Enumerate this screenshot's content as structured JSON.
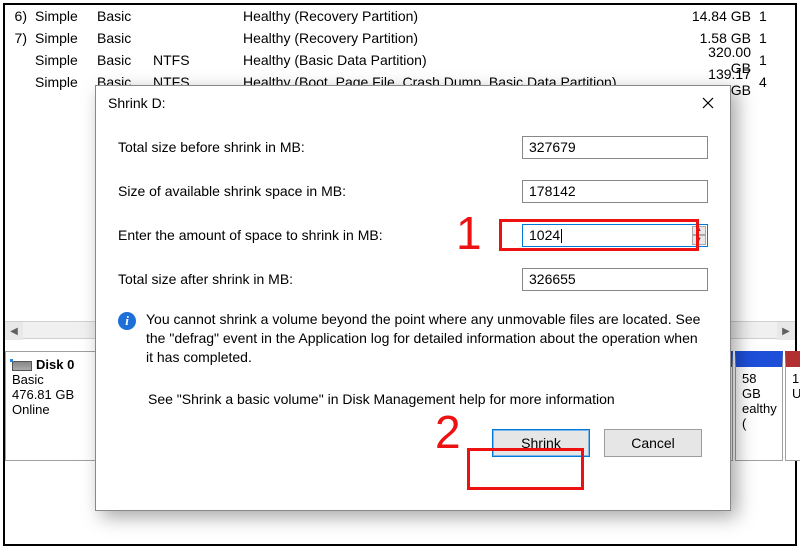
{
  "bg": {
    "rows": [
      {
        "num": "6)",
        "layout": "Simple",
        "type": "Basic",
        "fs": "",
        "status": "Healthy (Recovery Partition)",
        "cap": "14.84 GB",
        "free": "1"
      },
      {
        "num": "7)",
        "layout": "Simple",
        "type": "Basic",
        "fs": "",
        "status": "Healthy (Recovery Partition)",
        "cap": "1.58 GB",
        "free": "1"
      },
      {
        "num": "",
        "layout": "Simple",
        "type": "Basic",
        "fs": "NTFS",
        "status": "Healthy (Basic Data Partition)",
        "cap": "320.00 GB",
        "free": "1"
      },
      {
        "num": "",
        "layout": "Simple",
        "type": "Basic",
        "fs": "NTFS",
        "status": "Healthy (Boot, Page File, Crash Dump, Basic Data Partition)",
        "cap": "139.17 GB",
        "free": "4"
      }
    ]
  },
  "disk": {
    "name": "Disk 0",
    "type": "Basic",
    "cap": "476.81 GB",
    "state": "Online",
    "vol_right": {
      "line1": "58 GB",
      "line2": "ealthy ("
    },
    "vol_far": {
      "line1": "1:",
      "line2": "U"
    }
  },
  "dialog": {
    "title": "Shrink D:",
    "labels": {
      "total_before": "Total size before shrink in MB:",
      "avail": "Size of available shrink space in MB:",
      "enter": "Enter the amount of space to shrink in MB:",
      "total_after": "Total size after shrink in MB:"
    },
    "values": {
      "total_before": "327679",
      "avail": "178142",
      "enter": "1024",
      "total_after": "326655"
    },
    "info": "You cannot shrink a volume beyond the point where any unmovable files are located. See the \"defrag\" event in the Application log for detailed information about the operation when it has completed.",
    "help": "See \"Shrink a basic volume\" in Disk Management help for more information",
    "buttons": {
      "shrink": "Shrink",
      "cancel": "Cancel"
    }
  },
  "anno": {
    "one": "1",
    "two": "2"
  }
}
